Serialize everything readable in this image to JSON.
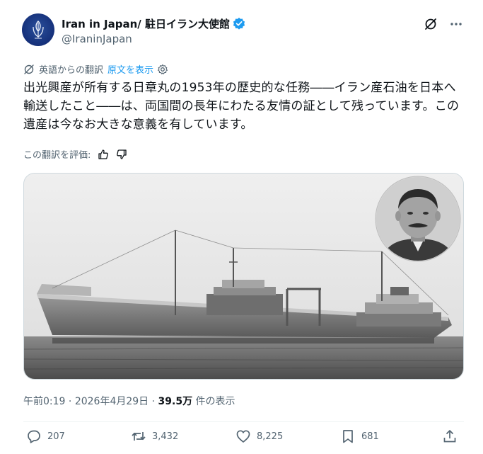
{
  "account": {
    "name": "Iran in Japan/ 駐日イラン大使館",
    "handle": "@IraninJapan"
  },
  "translation": {
    "label": "英語からの翻訳",
    "show_original": "原文を表示"
  },
  "tweet": {
    "text": "出光興産が所有する日章丸の1953年の歴史的な任務――イラン産石油を日本へ輸送したこと――は、両国間の長年にわたる友情の証として残っています。この遺産は今なお大きな意義を有しています。"
  },
  "rating": {
    "label": "この翻訳を評価:"
  },
  "meta": {
    "time": "午前0:19",
    "sep1": " · ",
    "date": "2026年4月29日",
    "sep2": " · ",
    "views": "39.5万",
    "views_suffix": " 件の表示"
  },
  "actions": {
    "replies": "207",
    "reposts": "3,432",
    "likes": "8,225",
    "bookmarks": "681"
  },
  "colors": {
    "accent": "#1d9bf0",
    "text": "#0f1419",
    "muted": "#536471"
  },
  "icons": [
    "grok-icon",
    "more-icon",
    "translate-icon",
    "gear-icon",
    "thumbs-up-icon",
    "thumbs-down-icon",
    "verified-badge-icon",
    "reply-icon",
    "repost-icon",
    "like-icon",
    "bookmark-icon",
    "share-icon"
  ]
}
